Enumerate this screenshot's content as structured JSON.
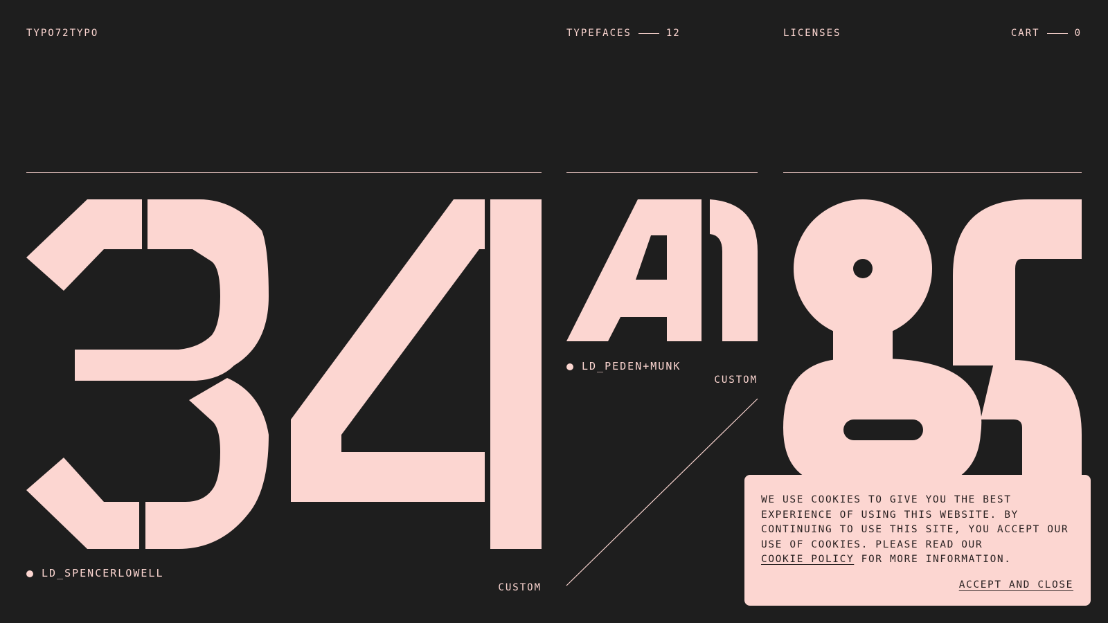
{
  "nav": {
    "logo": "TYPO72TYPO",
    "typefaces_label": "TYPEFACES",
    "typefaces_count": "12",
    "licenses_label": "LICENSES",
    "cart_label": "CART",
    "cart_count": "0"
  },
  "cards": [
    {
      "glyphs": "34",
      "name": "LD_SPENCERLOWELL",
      "tag": "CUSTOM"
    },
    {
      "glyphs": "A1",
      "name": "LD_PEDEN+MUNK",
      "tag": "CUSTOM"
    },
    {
      "glyphs": "&&"
    }
  ],
  "cookie": {
    "text_before": "WE USE COOKIES TO GIVE YOU THE BEST EXPERIENCE OF USING THIS WEBSITE. BY CONTINUING TO USE THIS SITE, YOU ACCEPT OUR USE OF COOKIES. PLEASE READ OUR",
    "link": "COOKIE POLICY",
    "text_after": "FOR MORE INFORMATION.",
    "accept": "ACCEPT AND CLOSE"
  },
  "colors": {
    "background": "#1e1e1e",
    "accent": "#fcd6d1"
  }
}
